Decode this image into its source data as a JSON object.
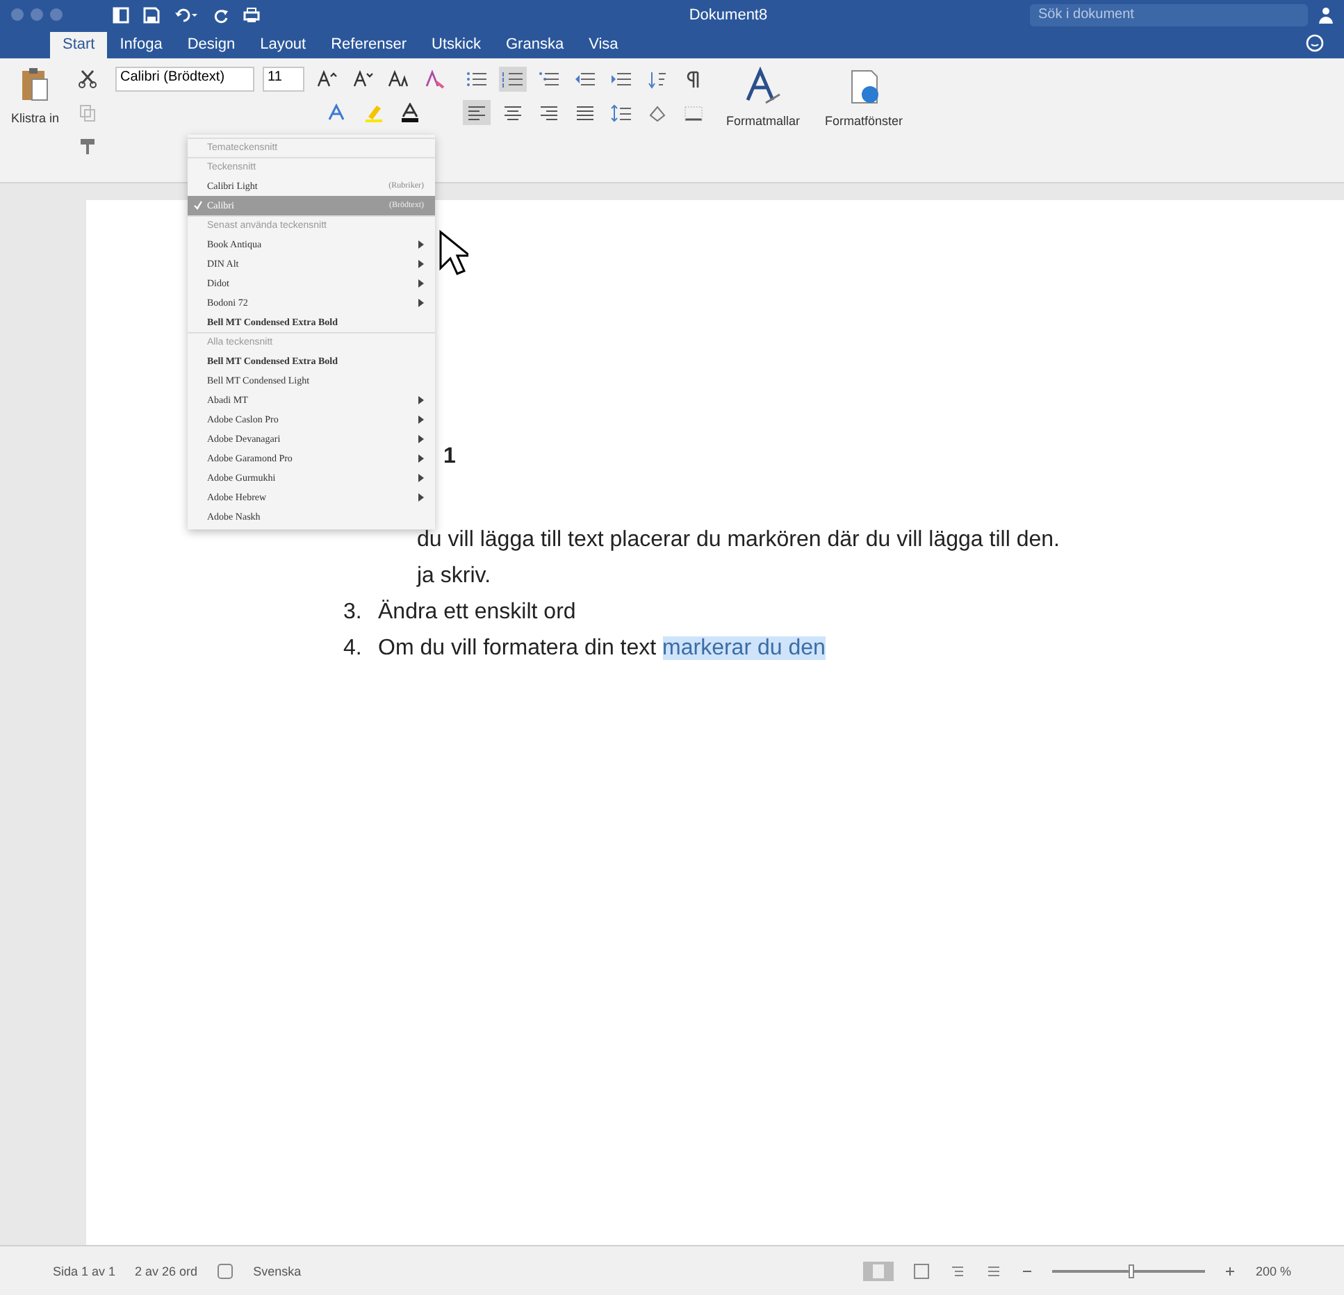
{
  "title_bar": {
    "title": "Dokument8",
    "search_placeholder": "Sök i dokument"
  },
  "tabs": [
    {
      "label": "Start",
      "selected": true
    },
    {
      "label": "Infoga",
      "selected": false
    },
    {
      "label": "Design",
      "selected": false
    },
    {
      "label": "Layout",
      "selected": false
    },
    {
      "label": "Referenser",
      "selected": false
    },
    {
      "label": "Utskick",
      "selected": false
    },
    {
      "label": "Granska",
      "selected": false
    },
    {
      "label": "Visa",
      "selected": false
    }
  ],
  "ribbon": {
    "paste_label": "Klistra in",
    "font_name": "Calibri (Brödtext)",
    "font_size": "11",
    "styles_label": "Formatmallar",
    "styles_pane_label": "Formatfönster"
  },
  "font_menu": {
    "items": [
      {
        "kind": "header",
        "label": "Temateckensnitt"
      },
      {
        "kind": "header",
        "label": "Teckensnitt"
      },
      {
        "kind": "font",
        "label": "Calibri Light",
        "note": "(Rubriker)",
        "selected": false,
        "submenu": false,
        "bold": false
      },
      {
        "kind": "font",
        "label": "Calibri",
        "note": "(Brödtext)",
        "selected": true,
        "submenu": false,
        "bold": false
      },
      {
        "kind": "header",
        "label": "Senast använda teckensnitt"
      },
      {
        "kind": "font",
        "label": "Book Antiqua",
        "selected": false,
        "submenu": true,
        "bold": false
      },
      {
        "kind": "font",
        "label": "DIN Alt",
        "selected": false,
        "submenu": true,
        "bold": false
      },
      {
        "kind": "font",
        "label": "Didot",
        "selected": false,
        "submenu": true,
        "bold": false
      },
      {
        "kind": "font",
        "label": "Bodoni 72",
        "selected": false,
        "submenu": true,
        "bold": false
      },
      {
        "kind": "font",
        "label": "Bell MT Condensed Extra Bold",
        "selected": false,
        "submenu": false,
        "bold": true
      },
      {
        "kind": "header",
        "label": "Alla teckensnitt"
      },
      {
        "kind": "font",
        "label": "Bell MT Condensed Extra Bold",
        "selected": false,
        "submenu": false,
        "bold": true
      },
      {
        "kind": "font",
        "label": "Bell MT Condensed Light",
        "selected": false,
        "submenu": false,
        "bold": false
      },
      {
        "kind": "font",
        "label": "Abadi MT",
        "selected": false,
        "submenu": true,
        "bold": false
      },
      {
        "kind": "font",
        "label": "Adobe Caslon Pro",
        "selected": false,
        "submenu": true,
        "bold": false
      },
      {
        "kind": "font",
        "label": "Adobe Devanagari",
        "selected": false,
        "submenu": true,
        "bold": false
      },
      {
        "kind": "font",
        "label": "Adobe Garamond Pro",
        "selected": false,
        "submenu": true,
        "bold": false
      },
      {
        "kind": "font",
        "label": "Adobe Gurmukhi",
        "selected": false,
        "submenu": true,
        "bold": false
      },
      {
        "kind": "font",
        "label": "Adobe Hebrew",
        "selected": false,
        "submenu": true,
        "bold": false
      },
      {
        "kind": "font",
        "label": "Adobe Naskh",
        "selected": false,
        "submenu": false,
        "bold": false
      }
    ]
  },
  "document": {
    "lines": [
      {
        "kind": "heading",
        "text": "1"
      },
      {
        "kind": "fragment",
        "text": "du vill lägga till text placerar du markören där du vill lägga till den."
      },
      {
        "kind": "fragment",
        "text": "ja skriv."
      },
      {
        "kind": "item",
        "number": "3.",
        "text": "Ändra ett enskilt ord"
      },
      {
        "kind": "item",
        "number": "4.",
        "text": "Om du vill formatera din text ",
        "highlight": "markerar du den"
      }
    ]
  },
  "status_bar": {
    "page": "Sida 1 av 1",
    "words": "2 av 26 ord",
    "language": "Svenska",
    "zoom": "200 %",
    "zoom_slider": {
      "level": 0.5
    }
  }
}
